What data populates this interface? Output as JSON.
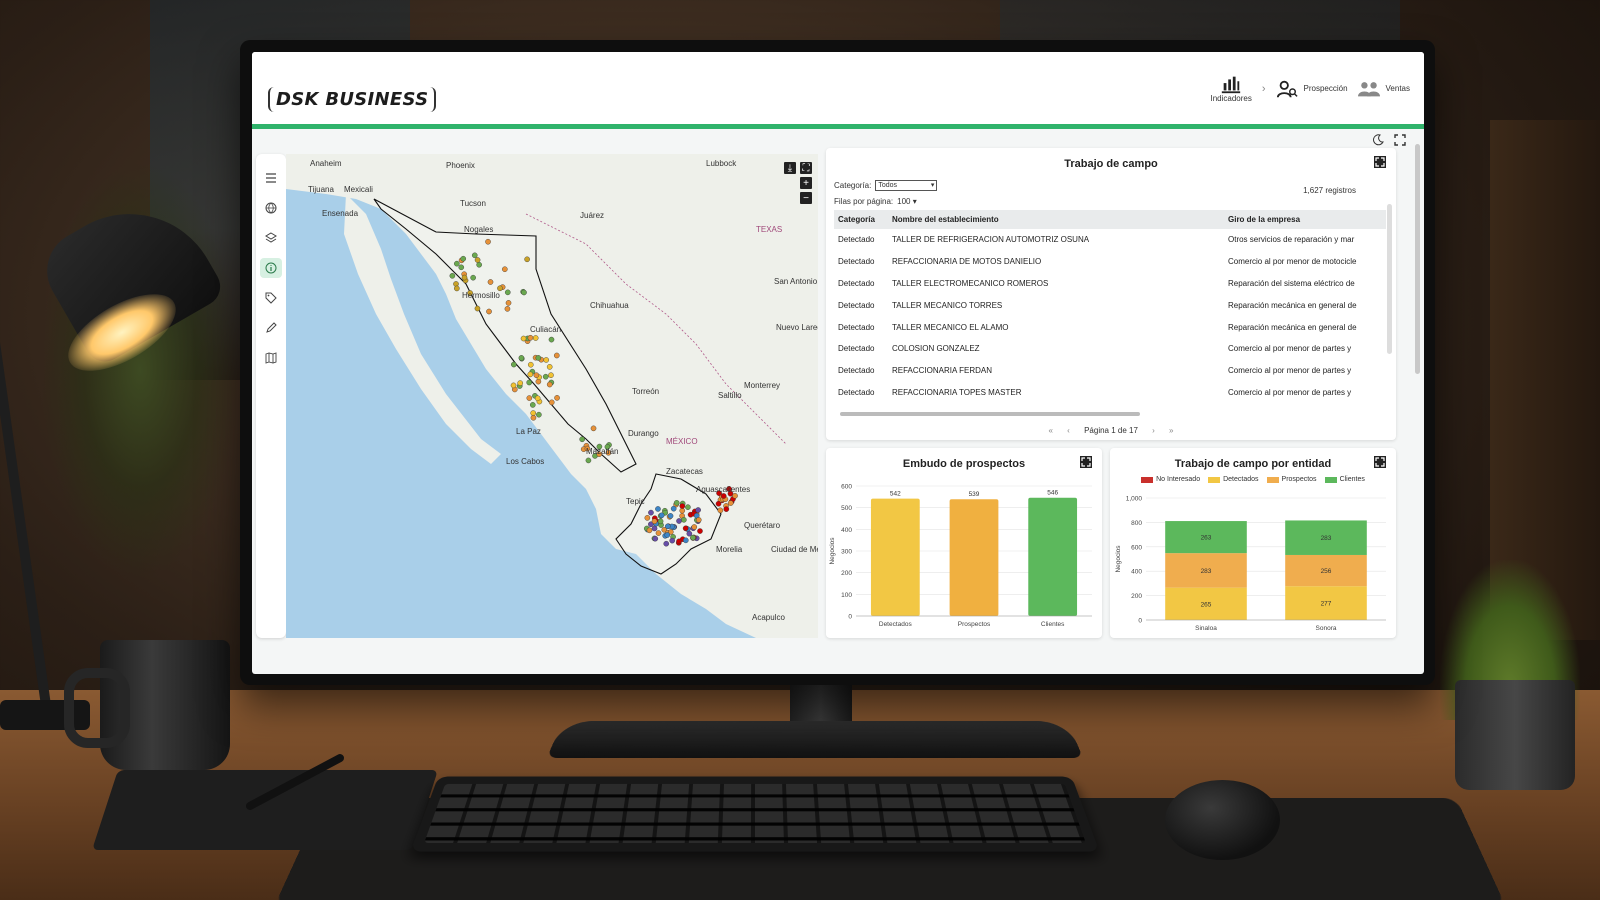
{
  "app": {
    "brand": "DSK BUSINESS",
    "accent_color": "#2fb36b",
    "nav": [
      {
        "label": "Indicadores",
        "icon": "bar-chart-icon"
      },
      {
        "label": "Prospección",
        "icon": "user-search-icon"
      },
      {
        "label": "Ventas",
        "icon": "users-icon"
      }
    ]
  },
  "sidebar": {
    "items": [
      {
        "name": "menu",
        "icon": "hamburger-icon"
      },
      {
        "name": "globe",
        "icon": "globe-icon"
      },
      {
        "name": "layers",
        "icon": "layers-icon"
      },
      {
        "name": "info",
        "icon": "info-icon",
        "active": true
      },
      {
        "name": "tag",
        "icon": "tag-icon"
      },
      {
        "name": "draw",
        "icon": "pencil-icon"
      },
      {
        "name": "map",
        "icon": "map-icon"
      }
    ]
  },
  "map": {
    "labels": [
      "Anaheim",
      "Phoenix",
      "Lubbock",
      "Tijuana",
      "Mexicali",
      "Ensenada",
      "Tucson",
      "Nogales",
      "Juárez",
      "Hermosillo",
      "Chihuahua",
      "Culiacán",
      "Torreón",
      "Monterrey",
      "Saltillo",
      "Durango",
      "La Paz",
      "Los Cabos",
      "MÉXICO",
      "Aguascalientes",
      "Morelia",
      "Ciudad de México",
      "Tepic",
      "Mazatlán",
      "Nuevo Laredo",
      "Zacatecas",
      "Querétaro",
      "Acapulco",
      "TEXAS",
      "San Antonio"
    ]
  },
  "table": {
    "title": "Trabajo de campo",
    "category_label": "Categoría:",
    "category_value": "Todos",
    "rows_label": "Filas por página:",
    "rows_value": "100",
    "records": "1,627 registros",
    "columns": [
      "Categoría",
      "Nombre del establecimiento",
      "Giro de la empresa"
    ],
    "rows": [
      [
        "Detectado",
        "TALLER DE REFRIGERACION AUTOMOTRIZ OSUNA",
        "Otros servicios de reparación y mar"
      ],
      [
        "Detectado",
        "REFACCIONARIA DE MOTOS DANIELIO",
        "Comercio al por menor de motocicle"
      ],
      [
        "Detectado",
        "TALLER ELECTROMECANICO ROMEROS",
        "Reparación del sistema eléctrico de"
      ],
      [
        "Detectado",
        "TALLER MECANICO TORRES",
        "Reparación mecánica en general de"
      ],
      [
        "Detectado",
        "TALLER MECANICO EL ALAMO",
        "Reparación mecánica en general de"
      ],
      [
        "Detectado",
        "COLOSION GONZALEZ",
        "Comercio al por menor de partes y"
      ],
      [
        "Detectado",
        "REFACCIONARIA FERDAN",
        "Comercio al por menor de partes y"
      ],
      [
        "Detectado",
        "REFACCIONARIA TOPES MASTER",
        "Comercio al por menor de partes y"
      ]
    ],
    "pager": {
      "first": "«",
      "prev": "‹",
      "label": "Página 1 de 17",
      "next": "›",
      "last": "»"
    }
  },
  "chart_data": [
    {
      "type": "bar",
      "title": "Embudo de prospectos",
      "ylabel": "Negocios",
      "categories": [
        "Detectados",
        "Prospectos",
        "Clientes"
      ],
      "values": [
        542,
        539,
        546
      ],
      "colors": [
        "#f2c744",
        "#f0b040",
        "#5cb85c"
      ],
      "ylim": [
        0,
        600
      ],
      "yticks": [
        0,
        100,
        200,
        300,
        400,
        500,
        600
      ],
      "grid": true
    },
    {
      "type": "bar",
      "stacked": true,
      "title": "Trabajo de campo por entidad",
      "ylabel": "Negocios",
      "legend_position": "top",
      "categories": [
        "Sinaloa",
        "Sonora"
      ],
      "series": [
        {
          "name": "No Interesado",
          "color": "#c9302c",
          "values": [
            0,
            0
          ]
        },
        {
          "name": "Detectados",
          "color": "#f2c744",
          "values": [
            265,
            277
          ]
        },
        {
          "name": "Prospectos",
          "color": "#f0ad4e",
          "values": [
            283,
            256
          ]
        },
        {
          "name": "Clientes",
          "color": "#5cb85c",
          "values": [
            263,
            283
          ]
        }
      ],
      "ylim": [
        0,
        1000
      ],
      "yticks": [
        "0",
        "200",
        "400",
        "600",
        "800",
        "1,000"
      ],
      "grid": true
    }
  ]
}
